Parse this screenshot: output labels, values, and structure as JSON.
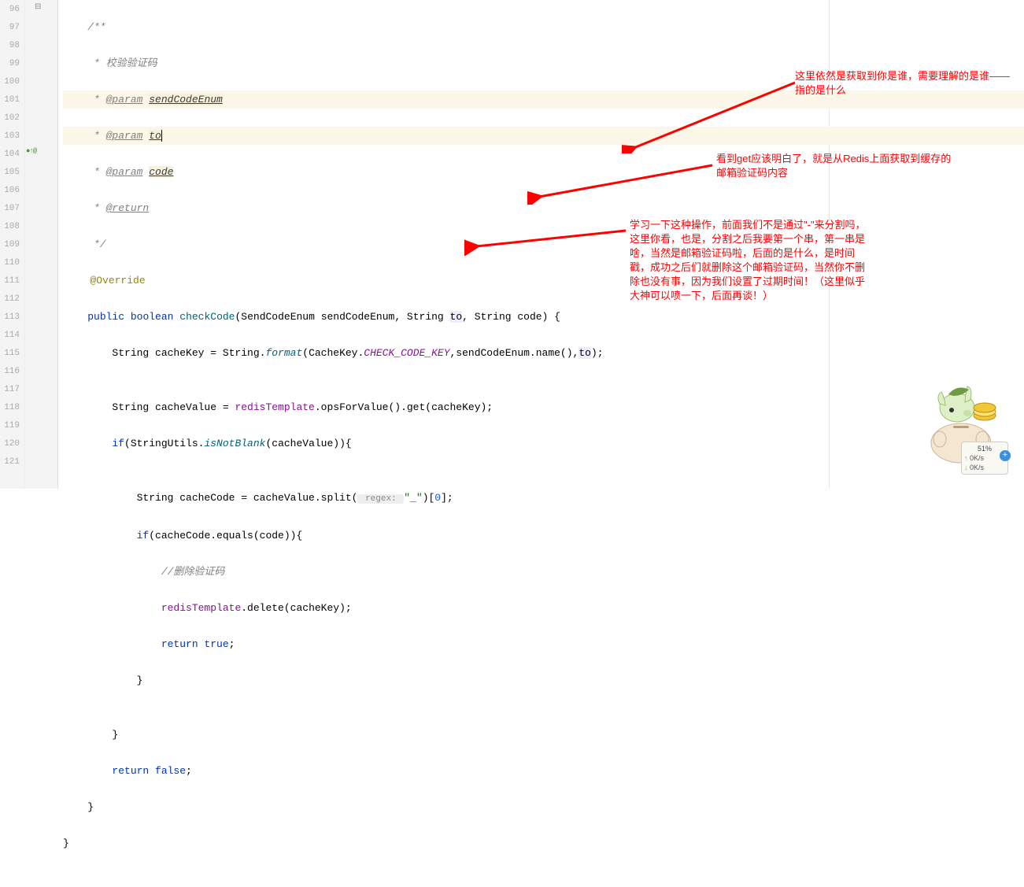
{
  "lines": {
    "start": 96,
    "end": 121
  },
  "code": {
    "l96": "    /**",
    "l97_pre": "     * ",
    "l97_txt": "校验验证码",
    "l98_pre": "     * ",
    "l98_tag": "@param",
    "l98_p": "sendCodeEnum",
    "l99_pre": "     * ",
    "l99_tag": "@param",
    "l99_p": "to",
    "l100_pre": "     * ",
    "l100_tag": "@param",
    "l100_p": "code",
    "l101_pre": "     * ",
    "l101_tag": "@return",
    "l102": "     */",
    "l103": "    @Override",
    "l104_kw1": "public",
    "l104_kw2": "boolean",
    "l104_m": "checkCode",
    "l104_sig": "(SendCodeEnum sendCodeEnum, String ",
    "l104_p": "to",
    "l104_sig2": ", String code) {",
    "l105_a": "        String cacheKey = String.",
    "l105_m": "format",
    "l105_b": "(CacheKey.",
    "l105_c": "CHECK_CODE_KEY",
    "l105_d": ",sendCodeEnum.name(),",
    "l105_p": "to",
    "l105_e": ");",
    "l106": "",
    "l107_a": "        String cacheValue = ",
    "l107_f": "redisTemplate",
    "l107_b": ".opsForValue().get(cacheKey);",
    "l108_a": "        ",
    "l108_kw": "if",
    "l108_b": "(StringUtils.",
    "l108_m": "isNotBlank",
    "l108_c": "(cacheValue)){",
    "l109": "",
    "l110_a": "            String cacheCode = cacheValue.split(",
    "l110_h": " regex: ",
    "l110_s": "\"_\"",
    "l110_b": ")[",
    "l110_n": "0",
    "l110_c": "];",
    "l111_a": "            ",
    "l111_kw": "if",
    "l111_b": "(cacheCode.equals(code)){",
    "l112_a": "                ",
    "l112_c": "//删除验证码",
    "l113_a": "                ",
    "l113_f": "redisTemplate",
    "l113_b": ".delete(cacheKey);",
    "l114_a": "                ",
    "l114_kw": "return true",
    "l114_b": ";",
    "l115": "            }",
    "l116": "",
    "l117": "        }",
    "l118_a": "        ",
    "l118_kw": "return false",
    "l118_b": ";",
    "l119": "    }",
    "l120": "}"
  },
  "annotations": {
    "a1": "这里依然是获取到你是谁，需要理解的是谁——指的是什么",
    "a2": "看到get应该明白了，就是从Redis上面获取到缓存的邮箱验证码内容",
    "a3": "学习一下这种操作，前面我们不是通过\"-\"来分割吗，这里你看，也是，分割之后我要第一个串，第一串是啥，当然是邮箱验证码啦，后面的是什么，是时间戳，成功之后们就删除这个邮箱验证码，当然你不删除也没有事，因为我们设置了过期时间！（这里似乎大神可以喷一下，后面再谈！）"
  },
  "mascot": {
    "percent": "51%",
    "up": "0K/s",
    "down": "0K/s"
  },
  "marker": "●↑@"
}
